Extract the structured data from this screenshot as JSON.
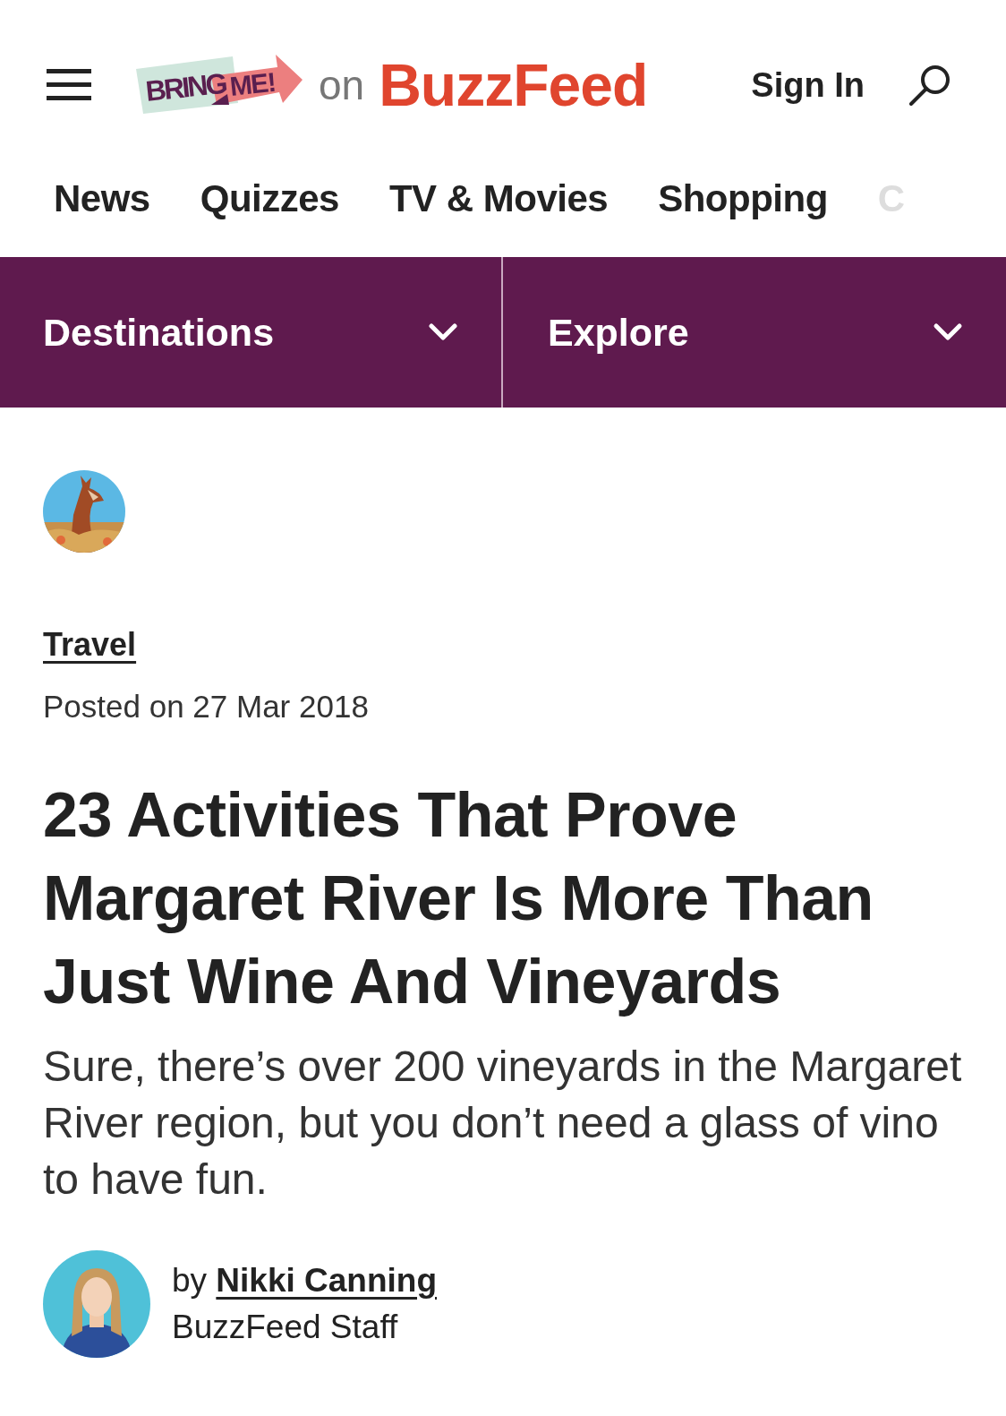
{
  "header": {
    "logo": {
      "word_1": "BRING",
      "word_2": "ME!"
    },
    "connector": "on",
    "brand": "BuzzFeed",
    "sign_in": "Sign In"
  },
  "nav": [
    {
      "label": "News",
      "faded": false
    },
    {
      "label": "Quizzes",
      "faded": false
    },
    {
      "label": "TV & Movies",
      "faded": false
    },
    {
      "label": "Shopping",
      "faded": false
    },
    {
      "label": "C",
      "faded": true
    }
  ],
  "dropdowns": [
    {
      "label": "Destinations"
    },
    {
      "label": "Explore"
    }
  ],
  "article": {
    "category": "Travel",
    "posted": "Posted on 27 Mar 2018",
    "title": "23 Activities That Prove Margaret River Is More Than Just Wine And Vineyards",
    "description": "Sure, there’s over 200 vineyards in the Margaret River region, but you don’t need a glass of vino to have fun.",
    "byline": {
      "by": "by",
      "author": "Nikki Canning",
      "role": "BuzzFeed Staff"
    }
  }
}
